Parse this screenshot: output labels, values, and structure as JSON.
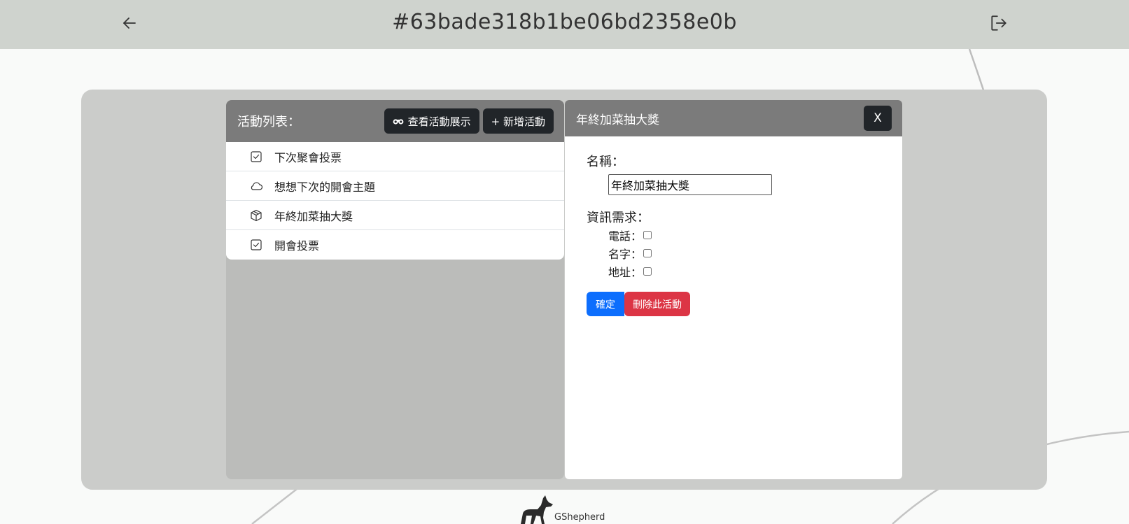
{
  "header": {
    "title": "#63bade318b1be06bd2358e0b"
  },
  "list_panel": {
    "title": "活動列表：",
    "view_button_label": "查看活動展示",
    "add_button_label": "+ 新增活動",
    "items": [
      {
        "label": "下次聚會投票",
        "icon": "checkbox-icon"
      },
      {
        "label": "想想下次的開會主題",
        "icon": "cloud-icon"
      },
      {
        "label": "年終加菜抽大獎",
        "icon": "box-icon"
      },
      {
        "label": "開會投票",
        "icon": "checkbox-icon"
      }
    ]
  },
  "detail_panel": {
    "title": "年終加菜抽大獎",
    "close_label": "X",
    "name_label": "名稱：",
    "name_value": "年終加菜抽大獎",
    "requirements_label": "資訊需求：",
    "requirements": [
      {
        "label": "電話：",
        "checked": false
      },
      {
        "label": "名字：",
        "checked": false
      },
      {
        "label": "地址：",
        "checked": false
      }
    ],
    "confirm_label": "確定",
    "delete_label": "刪除此活動"
  },
  "footer": {
    "brand": "GShepherd"
  }
}
